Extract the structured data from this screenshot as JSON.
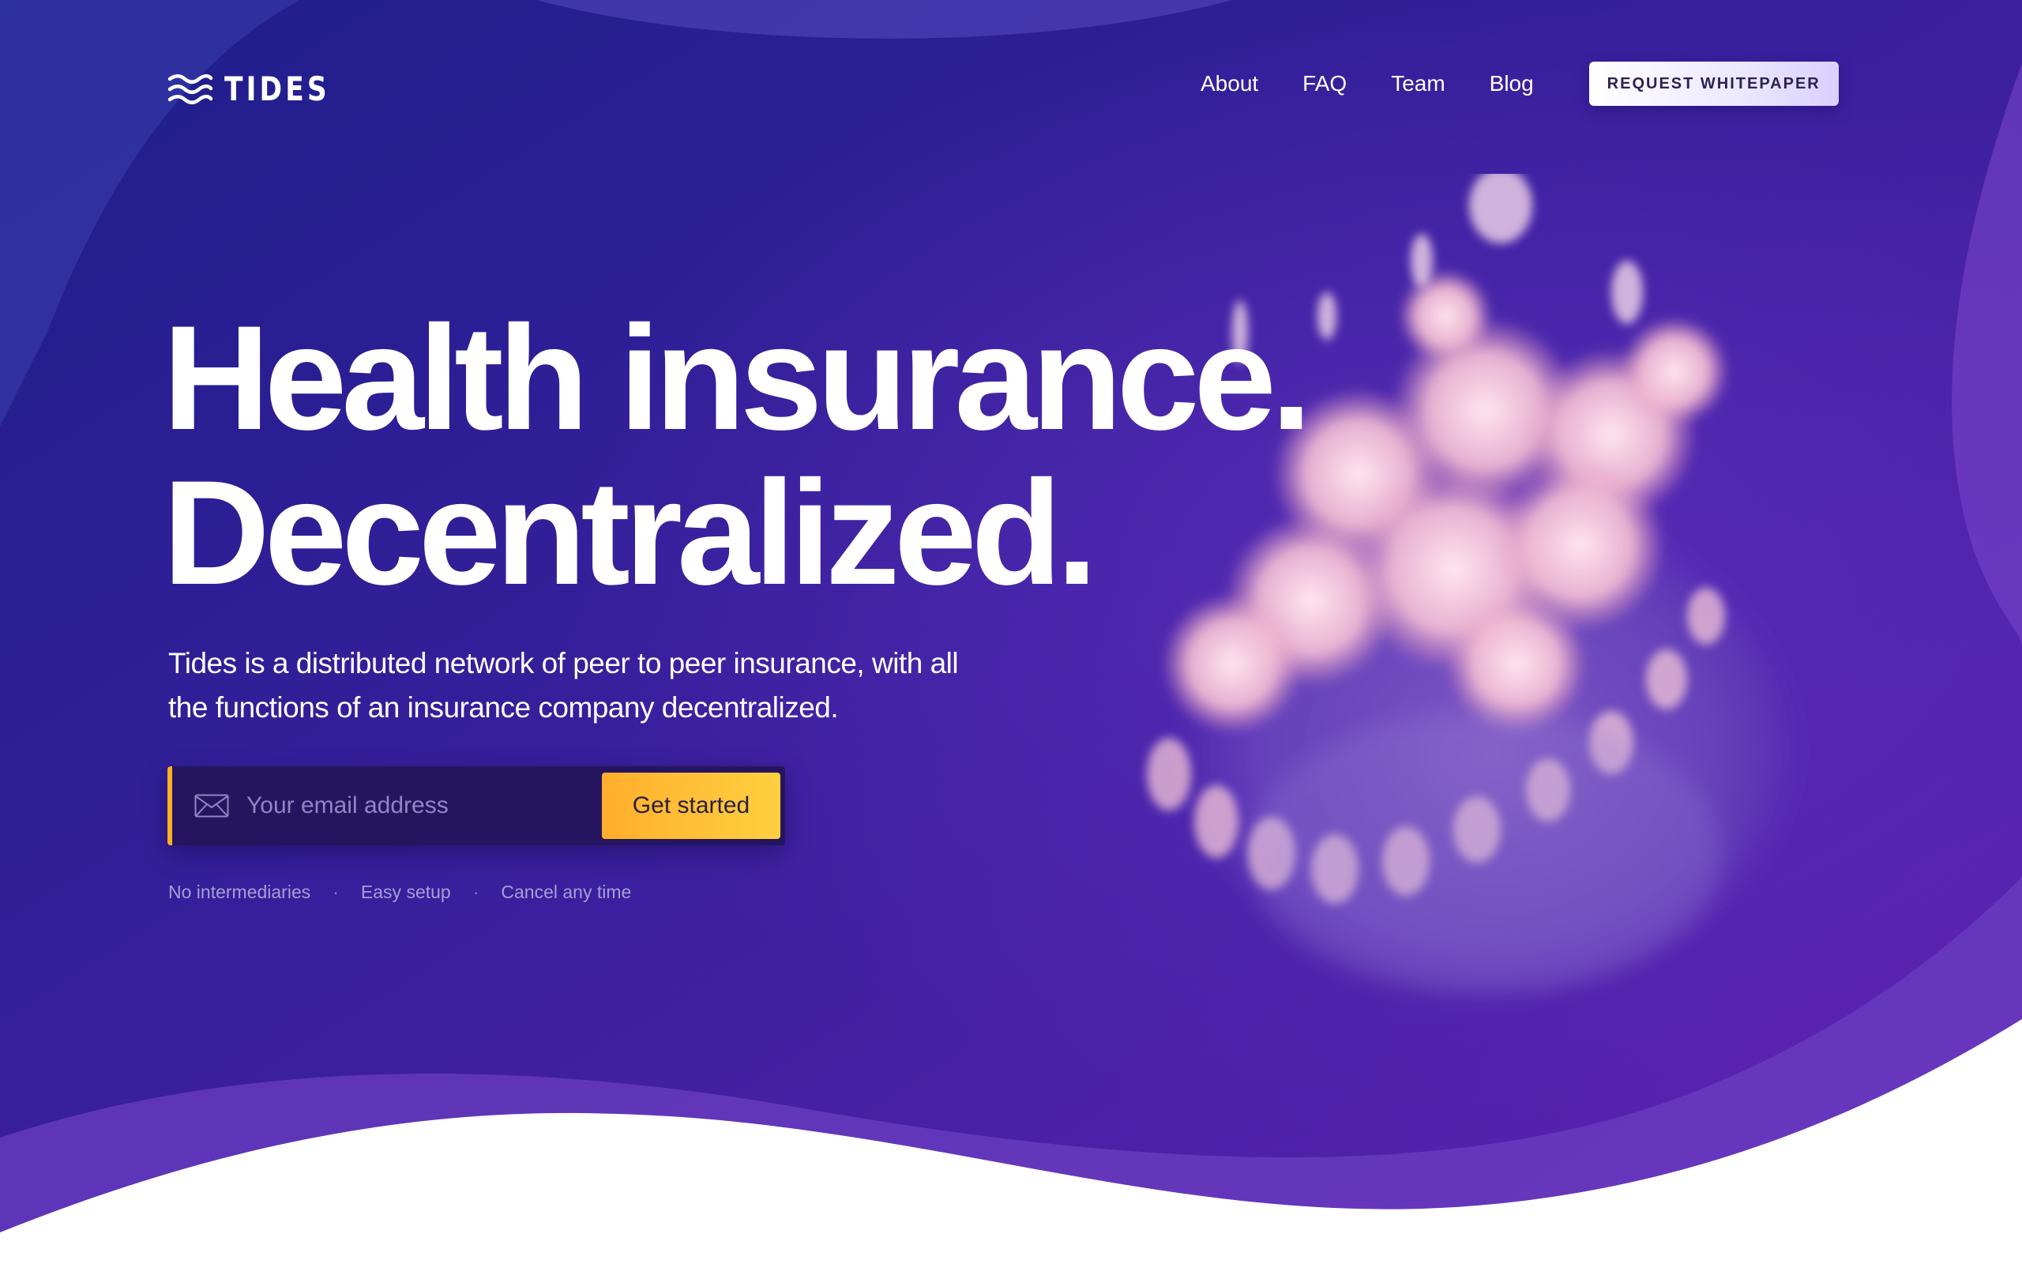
{
  "brand": {
    "name": "TIDES",
    "logo_icon": "waves-icon"
  },
  "nav": {
    "links": [
      "About",
      "FAQ",
      "Team",
      "Blog"
    ],
    "cta_label": "REQUEST WHITEPAPER"
  },
  "hero": {
    "headline_line1": "Health insurance.",
    "headline_line2": "Decentralized.",
    "subtext": "Tides is a distributed network of peer to peer insurance, with all the functions of an insurance company decentralized.",
    "image_icon": "jellyfish-illustration"
  },
  "signup": {
    "email_placeholder": "Your email address",
    "email_value": "",
    "input_icon": "mail-icon",
    "button_label": "Get started"
  },
  "features": [
    "No intermediaries",
    "Easy setup",
    "Cancel any time"
  ],
  "colors": {
    "background_start": "#1f1e8c",
    "background_end": "#5a20ad",
    "accent": "#ffb11f",
    "text_primary": "#ffffff",
    "text_muted": "#a59fd6",
    "input_background": "#25155f"
  }
}
